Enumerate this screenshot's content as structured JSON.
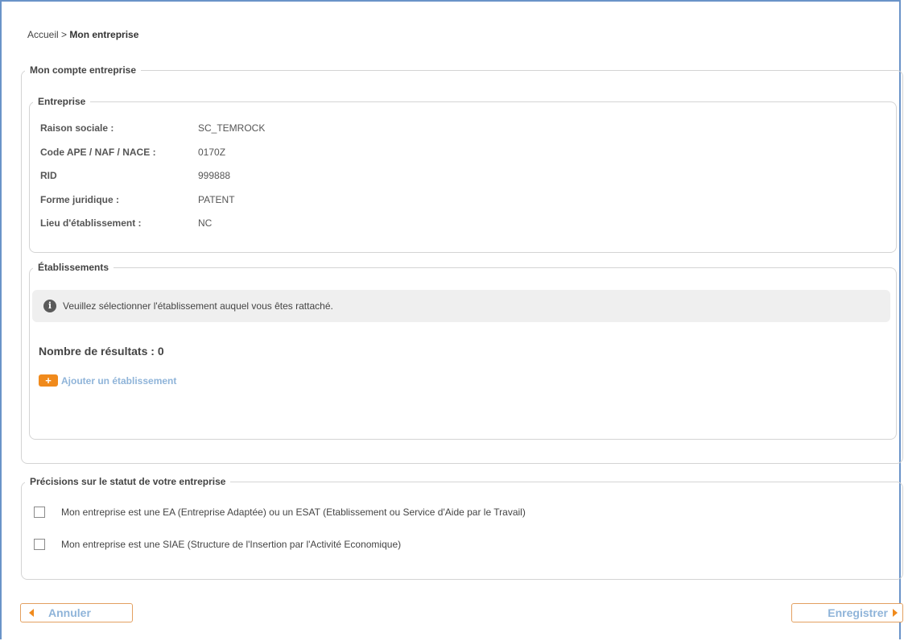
{
  "breadcrumb": {
    "home": "Accueil",
    "separator": ">",
    "current": "Mon entreprise"
  },
  "account": {
    "legend": "Mon compte entreprise"
  },
  "company": {
    "legend": "Entreprise",
    "fields": [
      {
        "label": "Raison sociale :",
        "value": "SC_TEMROCK"
      },
      {
        "label": "Code APE / NAF / NACE :",
        "value": "0170Z"
      },
      {
        "label": "RID",
        "value": "999888"
      },
      {
        "label": "Forme juridique :",
        "value": "PATENT"
      },
      {
        "label": "Lieu d'établissement :",
        "value": "NC"
      }
    ]
  },
  "establishments": {
    "legend": "Établissements",
    "notice": "Veuillez sélectionner l'établissement auquel vous êtes rattaché.",
    "results": "Nombre de résultats : 0",
    "add_label": "Ajouter un établissement",
    "add_icon": "plus-icon"
  },
  "status": {
    "legend": "Précisions sur le statut de votre entreprise",
    "options": [
      {
        "label": "Mon entreprise est une EA (Entreprise Adaptée) ou un ESAT (Etablissement ou Service d'Aide par le Travail)",
        "checked": false
      },
      {
        "label": "Mon entreprise est une SIAE (Structure de l'Insertion par l'Activité Economique)",
        "checked": false
      }
    ]
  },
  "buttons": {
    "cancel": "Annuler",
    "save": "Enregistrer"
  },
  "colors": {
    "accent_orange": "#f08a1c",
    "link_blue": "#8fb4d9",
    "frame_blue": "#6a93c8"
  }
}
